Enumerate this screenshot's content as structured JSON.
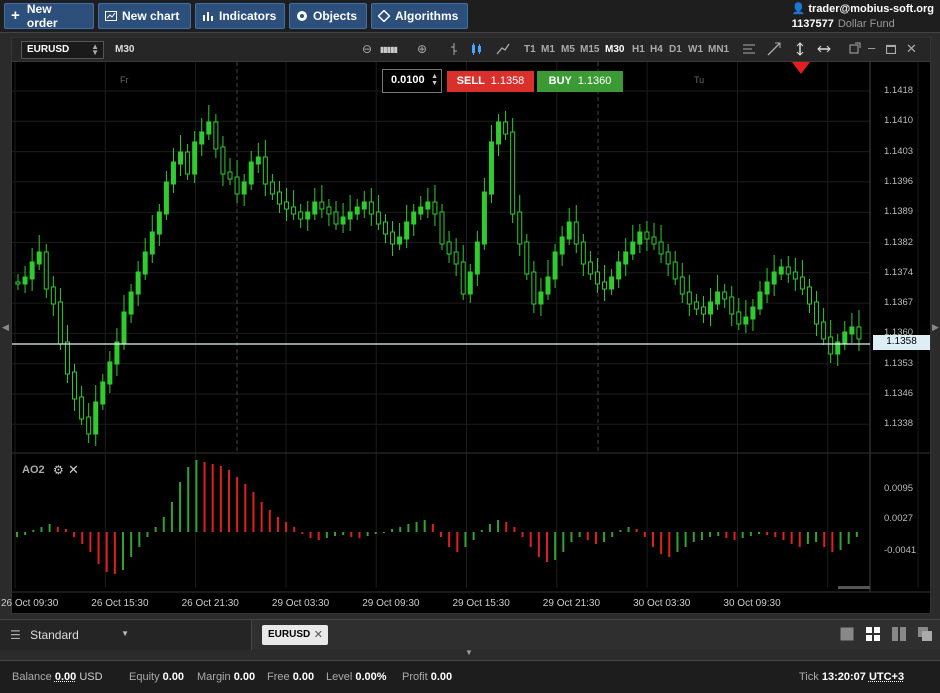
{
  "toolbar": {
    "new_order": "New order",
    "new_chart": "New chart",
    "indicators": "Indicators",
    "objects": "Objects",
    "algorithms": "Algorithms"
  },
  "account": {
    "user": "trader@mobius-soft.org",
    "number": "1137577",
    "fund": "Dollar Fund"
  },
  "chart": {
    "symbol": "EURUSD",
    "timeframe": "M30",
    "timeframes": [
      "T1",
      "M1",
      "M5",
      "M15",
      "M30",
      "H1",
      "H4",
      "D1",
      "W1",
      "MN1"
    ],
    "active_timeframe": "M30",
    "day_labels": [
      "Fr",
      "Tu"
    ],
    "lot": "0.0100",
    "sell_label": "SELL",
    "sell_price": "1.1358",
    "buy_label": "BUY",
    "buy_price": "1.1360",
    "current_price": "1.1358",
    "price_axis": [
      "1.1418",
      "1.1410",
      "1.1403",
      "1.1396",
      "1.1389",
      "1.1382",
      "1.1374",
      "1.1367",
      "1.1360",
      "1.1353",
      "1.1346",
      "1.1338"
    ],
    "indicator_name": "AO2",
    "indicator_axis": [
      "0.0095",
      "0.0027",
      "-0.0041"
    ],
    "time_axis": [
      "26 Oct 09:30",
      "26 Oct 15:30",
      "26 Oct 21:30",
      "29 Oct 03:30",
      "29 Oct 09:30",
      "29 Oct 15:30",
      "29 Oct 21:30",
      "30 Oct 03:30",
      "30 Oct 09:30"
    ],
    "colors": {
      "up": "#2ecc2e",
      "down": "#2ecc2e",
      "ao_up": "#2ea52e",
      "ao_down": "#e02020",
      "sell": "#d9302c",
      "buy": "#3b9a34"
    }
  },
  "workspace": {
    "name": "Standard",
    "tab": "EURUSD"
  },
  "status": {
    "balance_label": "Balance",
    "balance_value": "0.00",
    "balance_ccy": "USD",
    "equity_label": "Equity",
    "equity_value": "0.00",
    "margin_label": "Margin",
    "margin_value": "0.00",
    "free_label": "Free",
    "free_value": "0.00",
    "level_label": "Level",
    "level_value": "0.00%",
    "profit_label": "Profit",
    "profit_value": "0.00",
    "tick_label": "Tick",
    "tick_time": "13:20:07",
    "timezone": "UTC+3"
  }
}
